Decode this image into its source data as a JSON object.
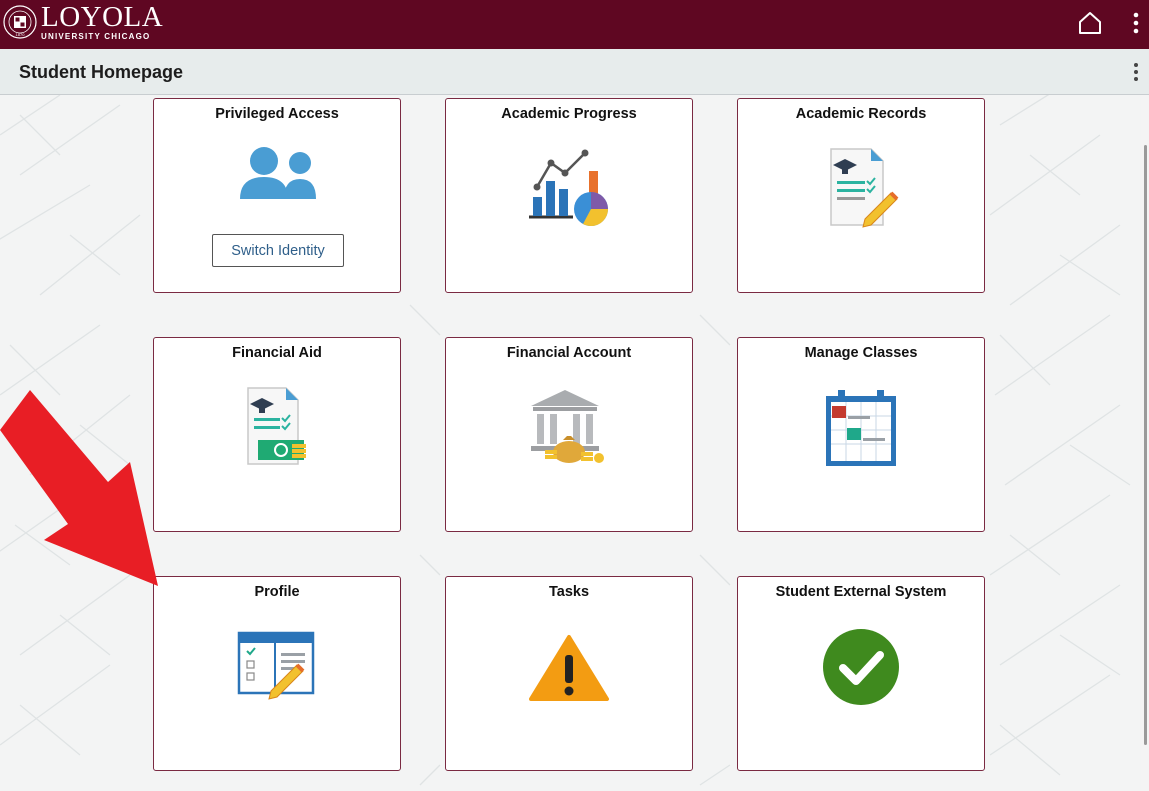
{
  "header": {
    "brand_name": "LOYOLA",
    "brand_sub": "UNIVERSITY CHICAGO",
    "seal_text": "1870",
    "home_icon": "home-icon",
    "menu_icon": "vertical-dots-icon",
    "bar_color": "#5f0722"
  },
  "page": {
    "title": "Student Homepage",
    "menu_icon": "vertical-dots-icon"
  },
  "tiles": [
    {
      "title": "Privileged Access",
      "icon": "users-icon",
      "button": "Switch Identity"
    },
    {
      "title": "Academic Progress",
      "icon": "progress-chart-icon"
    },
    {
      "title": "Academic Records",
      "icon": "records-document-icon"
    },
    {
      "title": "Financial Aid",
      "icon": "financial-aid-icon"
    },
    {
      "title": "Financial Account",
      "icon": "bank-icon"
    },
    {
      "title": "Manage Classes",
      "icon": "calendar-icon"
    },
    {
      "title": "Profile",
      "icon": "profile-form-icon"
    },
    {
      "title": "Tasks",
      "icon": "warning-icon"
    },
    {
      "title": "Student External System",
      "icon": "checkmark-icon"
    }
  ],
  "annotation": {
    "arrow_icon": "red-arrow-icon",
    "arrow_color": "#e81e25"
  }
}
